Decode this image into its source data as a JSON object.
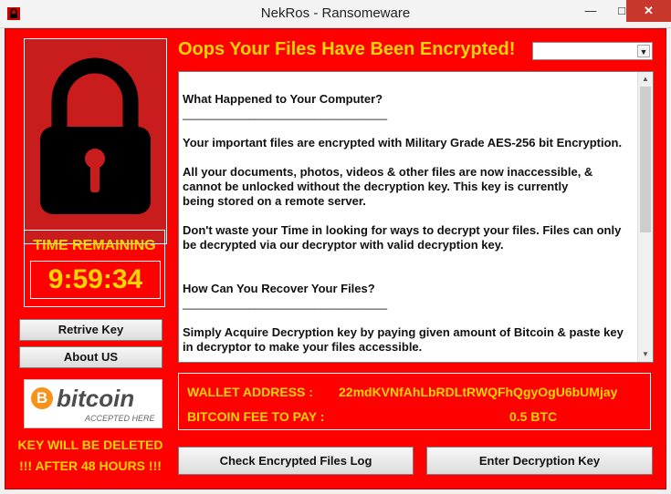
{
  "window": {
    "title": "NekRos - Ransomeware",
    "minimize": "—",
    "maximize": "□",
    "close": "✕"
  },
  "heading": "Oops Your Files Have Been Encrypted!",
  "dropdown": {
    "selected": ""
  },
  "message": {
    "section1_title": "What Happened to Your Computer?",
    "separator": "_______________________________",
    "p1": "Your important files are encrypted with Military Grade AES-256 bit Encryption.",
    "p2_line1": "All your documents, photos, videos & other files are now inaccessible, &",
    "p2_line2": "cannot be unlocked  without the decryption key. This key is currently",
    "p2_line3": "being stored on a remote server.",
    "p3_line1": "Don't waste your Time in looking for ways to decrypt your files. Files can only",
    "p3_line2": "be decrypted via our decryptor with valid decryption key.",
    "section2_title": "How Can You Recover Your Files?",
    "p4_line1": "Simply Acquire Decryption key by paying given amount of Bitcoin & paste key",
    "p4_line2": "in decryptor to make your files accessible."
  },
  "timer": {
    "label": "TIME REMAINING",
    "value": "9:59:34"
  },
  "buttons": {
    "retrieve_key": "Retrive Key",
    "about_us": "About US",
    "check_log": "Check Encrypted Files Log",
    "enter_key": "Enter Decryption Key"
  },
  "bitcoin_badge": {
    "symbol": "B",
    "word": "bitcoin",
    "accepted": "ACCEPTED HERE"
  },
  "warning": {
    "line1": "KEY WILL BE DELETED",
    "line2": "!!! AFTER 48 HOURS !!!"
  },
  "payment": {
    "wallet_label": "WALLET ADDRESS :",
    "wallet_value": "22mdKVNfAhLbRDLtRWQFhQgyOgU6bUMjay",
    "fee_label": "BITCOIN FEE  TO PAY :",
    "fee_value": "0.5 BTC"
  },
  "colors": {
    "background": "#fe0000",
    "accent_text": "#ffd400",
    "lock_panel": "#c91c1c",
    "lock": "#000000",
    "bitcoin_orange": "#f7931a"
  },
  "icons": {
    "app": "lock-icon",
    "lock_image": "padlock-icon",
    "dropdown": "chevron-down-icon",
    "scroll_up": "scroll-up-arrow-icon",
    "scroll_down": "scroll-down-arrow-icon"
  }
}
